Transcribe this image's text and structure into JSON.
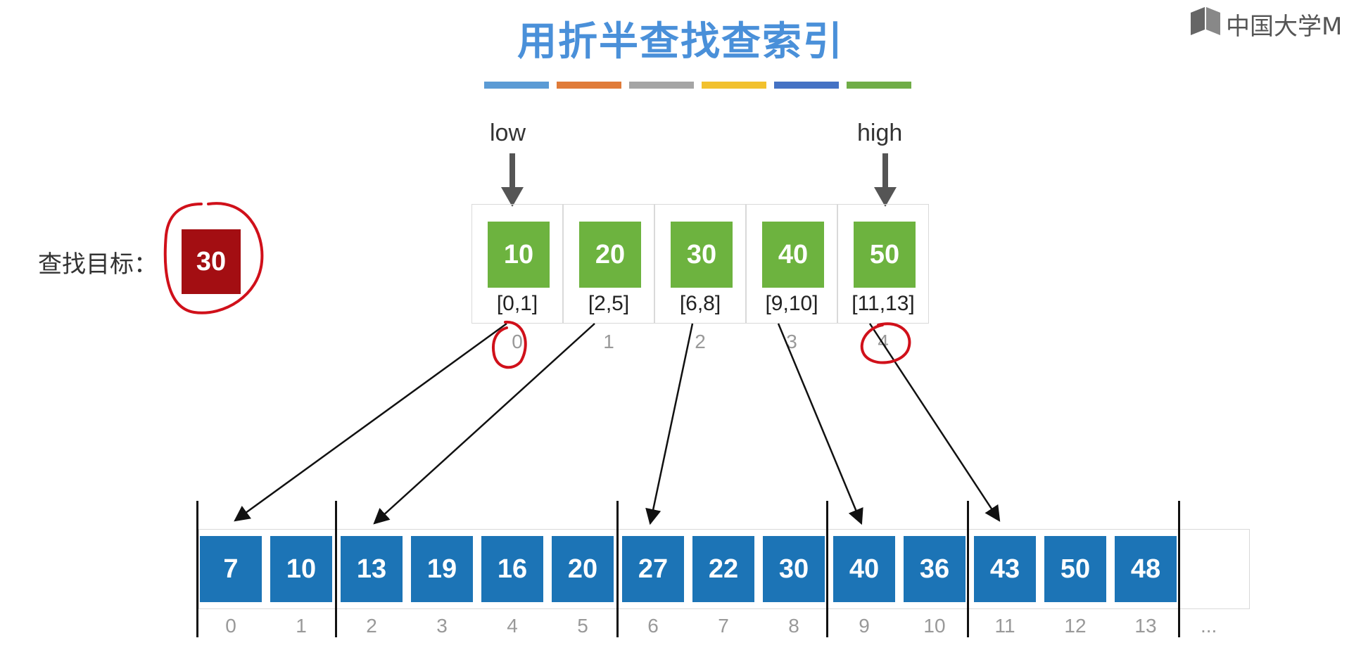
{
  "title": "用折半查找查索引",
  "logo_text": "中国大学M",
  "color_bars": [
    "#5b9bd5",
    "#e07b39",
    "#a5a5a5",
    "#f2c12e",
    "#4472c4",
    "#70ad47"
  ],
  "target": {
    "label": "查找目标：",
    "value": "30"
  },
  "pointers": {
    "low": "low",
    "high": "high"
  },
  "index_table": [
    {
      "key": "10",
      "range": "[0,1]",
      "index": "0"
    },
    {
      "key": "20",
      "range": "[2,5]",
      "index": "1"
    },
    {
      "key": "30",
      "range": "[6,8]",
      "index": "2"
    },
    {
      "key": "40",
      "range": "[9,10]",
      "index": "3"
    },
    {
      "key": "50",
      "range": "[11,13]",
      "index": "4"
    }
  ],
  "data_array": [
    {
      "value": "7",
      "index": "0"
    },
    {
      "value": "10",
      "index": "1"
    },
    {
      "value": "13",
      "index": "2"
    },
    {
      "value": "19",
      "index": "3"
    },
    {
      "value": "16",
      "index": "4"
    },
    {
      "value": "20",
      "index": "5"
    },
    {
      "value": "27",
      "index": "6"
    },
    {
      "value": "22",
      "index": "7"
    },
    {
      "value": "30",
      "index": "8"
    },
    {
      "value": "40",
      "index": "9"
    },
    {
      "value": "36",
      "index": "10"
    },
    {
      "value": "43",
      "index": "11"
    },
    {
      "value": "50",
      "index": "12"
    },
    {
      "value": "48",
      "index": "13"
    }
  ],
  "ellipsis": "...",
  "colors": {
    "title": "#4a90d9",
    "index_key": "#6db33f",
    "data_cell": "#1c74b6",
    "target": "#a30e12",
    "annotation": "#d0101a"
  }
}
